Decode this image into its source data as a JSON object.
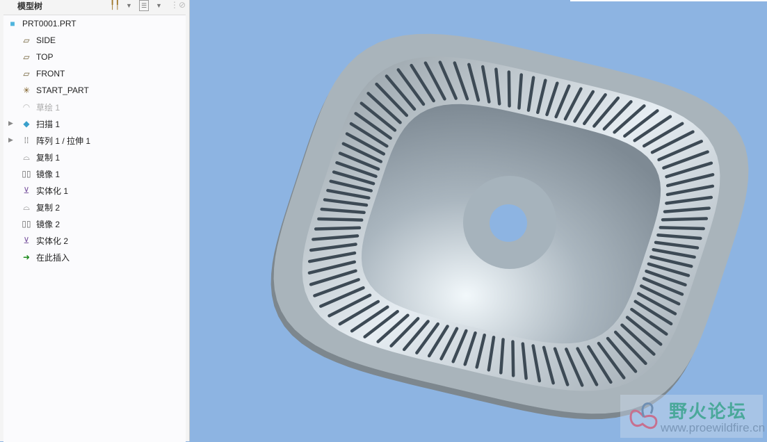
{
  "panel": {
    "title": "模型树"
  },
  "tree": [
    {
      "label": "PRT0001.PRT",
      "icon": "part-icon"
    },
    {
      "label": "SIDE",
      "icon": "datum-plane-icon"
    },
    {
      "label": "TOP",
      "icon": "datum-plane-icon"
    },
    {
      "label": "FRONT",
      "icon": "datum-plane-icon"
    },
    {
      "label": "START_PART",
      "icon": "coordinate-system-icon"
    },
    {
      "label": "草绘 1",
      "icon": "sketch-icon"
    },
    {
      "label": "扫描 1",
      "icon": "sweep-icon"
    },
    {
      "label": "阵列 1 / 拉伸 1",
      "icon": "pattern-icon"
    },
    {
      "label": "复制 1",
      "icon": "copy-icon"
    },
    {
      "label": "镜像 1",
      "icon": "mirror-icon"
    },
    {
      "label": "实体化 1",
      "icon": "solidify-icon"
    },
    {
      "label": "复制 2",
      "icon": "copy-icon"
    },
    {
      "label": "镜像 2",
      "icon": "mirror-icon"
    },
    {
      "label": "实体化 2",
      "icon": "solidify-icon"
    },
    {
      "label": "在此插入",
      "icon": "insert-here-icon"
    }
  ],
  "watermark": {
    "name": "野火论坛",
    "url": "www.proewildfire.cn"
  },
  "colors": {
    "background": "#8db4e2",
    "part": "#a9b4bb"
  }
}
